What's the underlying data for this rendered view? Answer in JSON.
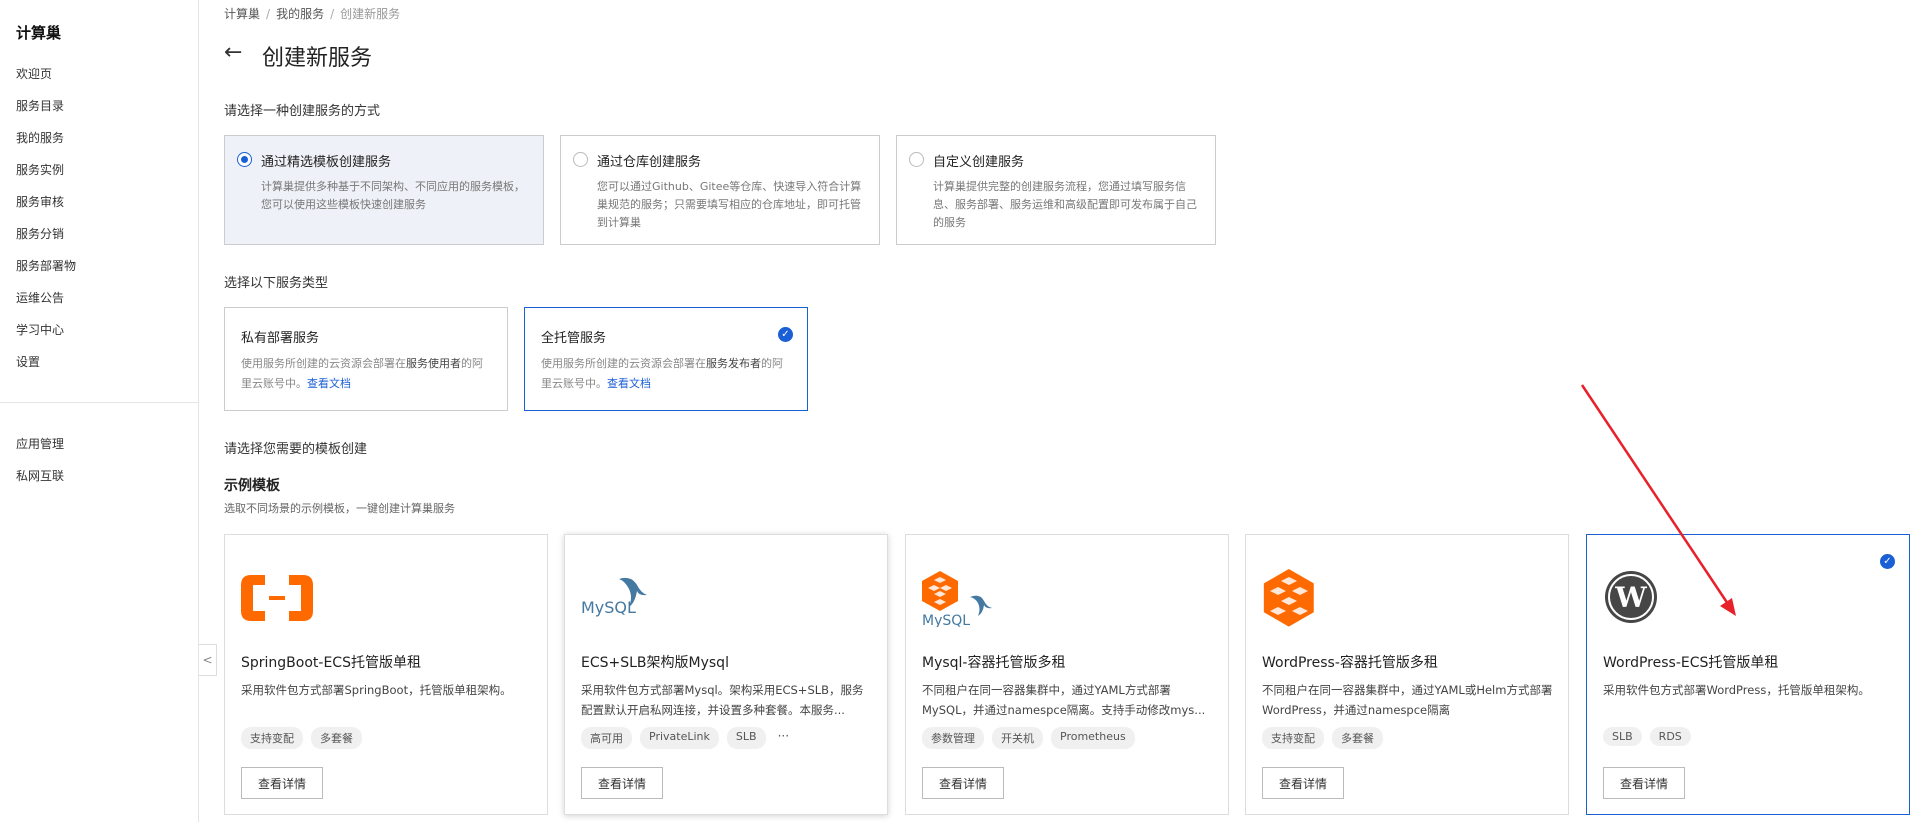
{
  "sidebar": {
    "title": "计算巢",
    "items": [
      "欢迎页",
      "服务目录",
      "我的服务",
      "服务实例",
      "服务审核",
      "服务分销",
      "服务部署物",
      "运维公告",
      "学习中心",
      "设置"
    ],
    "extra_items": [
      "应用管理",
      "私网互联"
    ],
    "collapse_glyph": "<"
  },
  "breadcrumb": [
    "计算巢",
    "我的服务",
    "创建新服务"
  ],
  "header": {
    "back_glyph": "←",
    "title": "创建新服务"
  },
  "method_section": {
    "label": "请选择一种创建服务的方式",
    "options": [
      {
        "title": "通过精选模板创建服务",
        "desc": "计算巢提供多种基于不同架构、不同应用的服务模板，您可以使用这些模板快速创建服务",
        "selected": true
      },
      {
        "title": "通过仓库创建服务",
        "desc": "您可以通过Github、Gitee等仓库、快速导入符合计算巢规范的服务；只需要填写相应的仓库地址，即可托管到计算巢",
        "selected": false
      },
      {
        "title": "自定义创建服务",
        "desc": "计算巢提供完整的创建服务流程，您通过填写服务信息、服务部署、服务运维和高级配置即可发布属于自己的服务",
        "selected": false
      }
    ]
  },
  "type_section": {
    "label": "选择以下服务类型",
    "options": [
      {
        "title": "私有部署服务",
        "desc_pre": "使用服务所创建的云资源会部署在",
        "desc_bold": "服务使用者",
        "desc_post": "的阿里云账号中。",
        "link": "查看文档",
        "selected": false
      },
      {
        "title": "全托管服务",
        "desc_pre": "使用服务所创建的云资源会部署在",
        "desc_bold": "服务发布者",
        "desc_post": "的阿里云账号中。",
        "link": "查看文档",
        "selected": true
      }
    ]
  },
  "template_section": {
    "label": "请选择您需要的模板创建",
    "heading": "示例模板",
    "desc": "选取不同场景的示例模板，一键创建计算巢服务",
    "templates": [
      {
        "logo": "aliyun-logo",
        "title": "SpringBoot-ECS托管版单租",
        "desc": "采用软件包方式部署SpringBoot，托管版单租架构。",
        "tags": [
          "支持变配",
          "多套餐"
        ],
        "more": "",
        "button": "查看详情",
        "selected": false
      },
      {
        "logo": "mysql-logo",
        "title": "ECS+SLB架构版Mysql",
        "desc": "采用软件包方式部署Mysql。架构采用ECS+SLB，服务配置默认开启私网连接，并设置多种套餐。本服务...",
        "tags": [
          "高可用",
          "PrivateLink",
          "SLB"
        ],
        "more": "···",
        "button": "查看详情",
        "selected": false
      },
      {
        "logo": "mysql-container-logo",
        "title": "Mysql-容器托管版多租",
        "desc": "不同租户在同一容器集群中，通过YAML方式部署MySQL，并通过namespce隔离。支持手动修改mys...",
        "tags": [
          "参数管理",
          "开关机",
          "Prometheus"
        ],
        "more": "",
        "button": "查看详情",
        "selected": false
      },
      {
        "logo": "container-logo",
        "title": "WordPress-容器托管版多租",
        "desc": "不同租户在同一容器集群中，通过YAML或Helm方式部署WordPress，并通过namespce隔离",
        "tags": [
          "支持变配",
          "多套餐"
        ],
        "more": "",
        "button": "查看详情",
        "selected": false
      },
      {
        "logo": "wordpress-logo",
        "title": "WordPress-ECS托管版单租",
        "desc": "采用软件包方式部署WordPress，托管版单租架构。",
        "tags": [
          "SLB",
          "RDS"
        ],
        "more": "",
        "button": "查看详情",
        "selected": true
      }
    ]
  },
  "logo_text": {
    "mysql": "MySQL"
  },
  "colors": {
    "accent": "#1a5fd6",
    "aliyun_orange": "#ff6a00",
    "annotation_arrow": "#e8202a"
  }
}
